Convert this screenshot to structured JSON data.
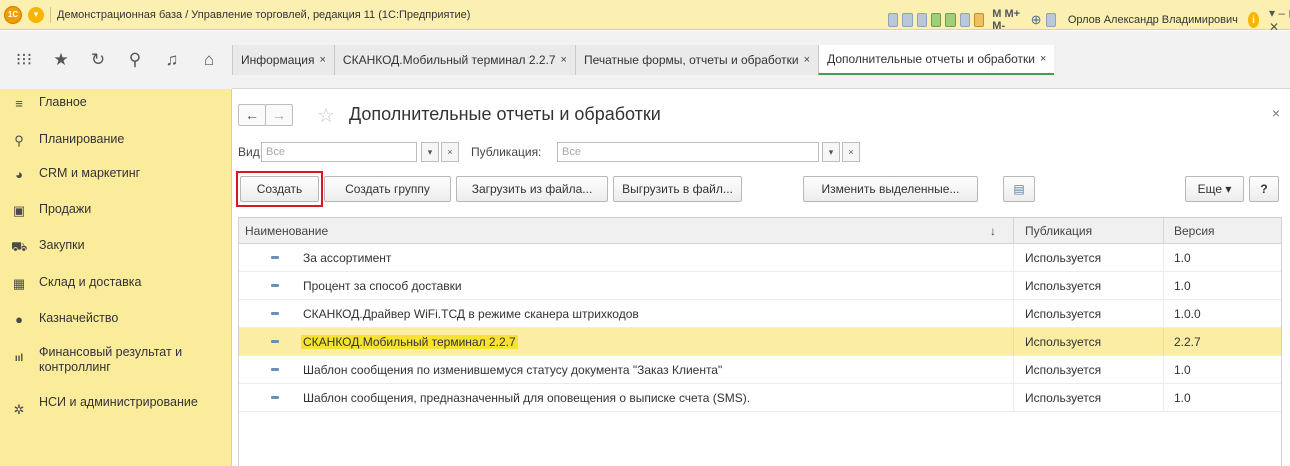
{
  "window": {
    "logo": "1С",
    "title": "Демонстрационная база / Управление торговлей, редакция 11  (1С:Предприятие)",
    "mm_buttons": "M  M+  M-",
    "user": "Орлов Александр Владимирович",
    "info_icon": "i",
    "window_controls": "▾  –  ◻  ✕"
  },
  "tabs": [
    {
      "label": "Информация",
      "close": "×"
    },
    {
      "label": "СКАНКОД.Мобильный терминал 2.2.7",
      "close": "×"
    },
    {
      "label": "Печатные формы, отчеты и обработки",
      "close": "×"
    },
    {
      "label": "Дополнительные отчеты и обработки",
      "close": "×"
    }
  ],
  "sidebar": {
    "items": [
      {
        "label": "Главное",
        "icon": "≡"
      },
      {
        "label": "Планирование",
        "icon": "⚲"
      },
      {
        "label": "CRM и маркетинг",
        "icon": "◕"
      },
      {
        "label": "Продажи",
        "icon": "▣"
      },
      {
        "label": "Закупки",
        "icon": "⛟"
      },
      {
        "label": "Склад и доставка",
        "icon": "▦"
      },
      {
        "label": "Казначейство",
        "icon": "●"
      },
      {
        "label": "Финансовый результат и контроллинг",
        "icon": "ııl"
      },
      {
        "label": "НСИ и администрирование",
        "icon": "✲"
      }
    ]
  },
  "page": {
    "back": "←",
    "forward": "→",
    "star": "☆",
    "title": "Дополнительные отчеты и обработки",
    "close": "×"
  },
  "filters": {
    "kind_label": "Вид:",
    "kind_placeholder": "Все",
    "publication_label": "Публикация:",
    "publication_placeholder": "Все",
    "dropdown": "▾",
    "clear": "×"
  },
  "toolbar": {
    "create": "Создать",
    "create_group": "Создать группу",
    "load_from_file": "Загрузить из файла...",
    "save_to_file": "Выгрузить в файл...",
    "edit_selected": "Изменить выделенные...",
    "list_icon": "▤",
    "more": "Еще ▾",
    "help": "?"
  },
  "table": {
    "columns": {
      "name": "Наименование",
      "sort": "↓",
      "publication": "Публикация",
      "version": "Версия"
    },
    "rows": [
      {
        "name": "За ассортимент",
        "publication": "Используется",
        "version": "1.0",
        "selected": false
      },
      {
        "name": "Процент за способ доставки",
        "publication": "Используется",
        "version": "1.0",
        "selected": false
      },
      {
        "name": "СКАНКОД.Драйвер WiFi.ТСД в режиме сканера штрихкодов",
        "publication": "Используется",
        "version": "1.0.0",
        "selected": false
      },
      {
        "name": "СКАНКОД.Мобильный терминал 2.2.7",
        "publication": "Используется",
        "version": "2.2.7",
        "selected": true
      },
      {
        "name": "Шаблон сообщения по изменившемуся статусу документа \"Заказ Клиента\"",
        "publication": "Используется",
        "version": "1.0",
        "selected": false
      },
      {
        "name": "Шаблон сообщения, предназначенный для оповещения о выписке счета (SMS).",
        "publication": "Используется",
        "version": "1.0",
        "selected": false
      }
    ]
  },
  "colors": {
    "sidebar_bg": "#fbec9b",
    "titlebar_bg": "#fbf0b2",
    "selected_row": "#fbeea4",
    "highlight_box": "#e0141e",
    "active_tab_underline": "#4a9d4a"
  }
}
